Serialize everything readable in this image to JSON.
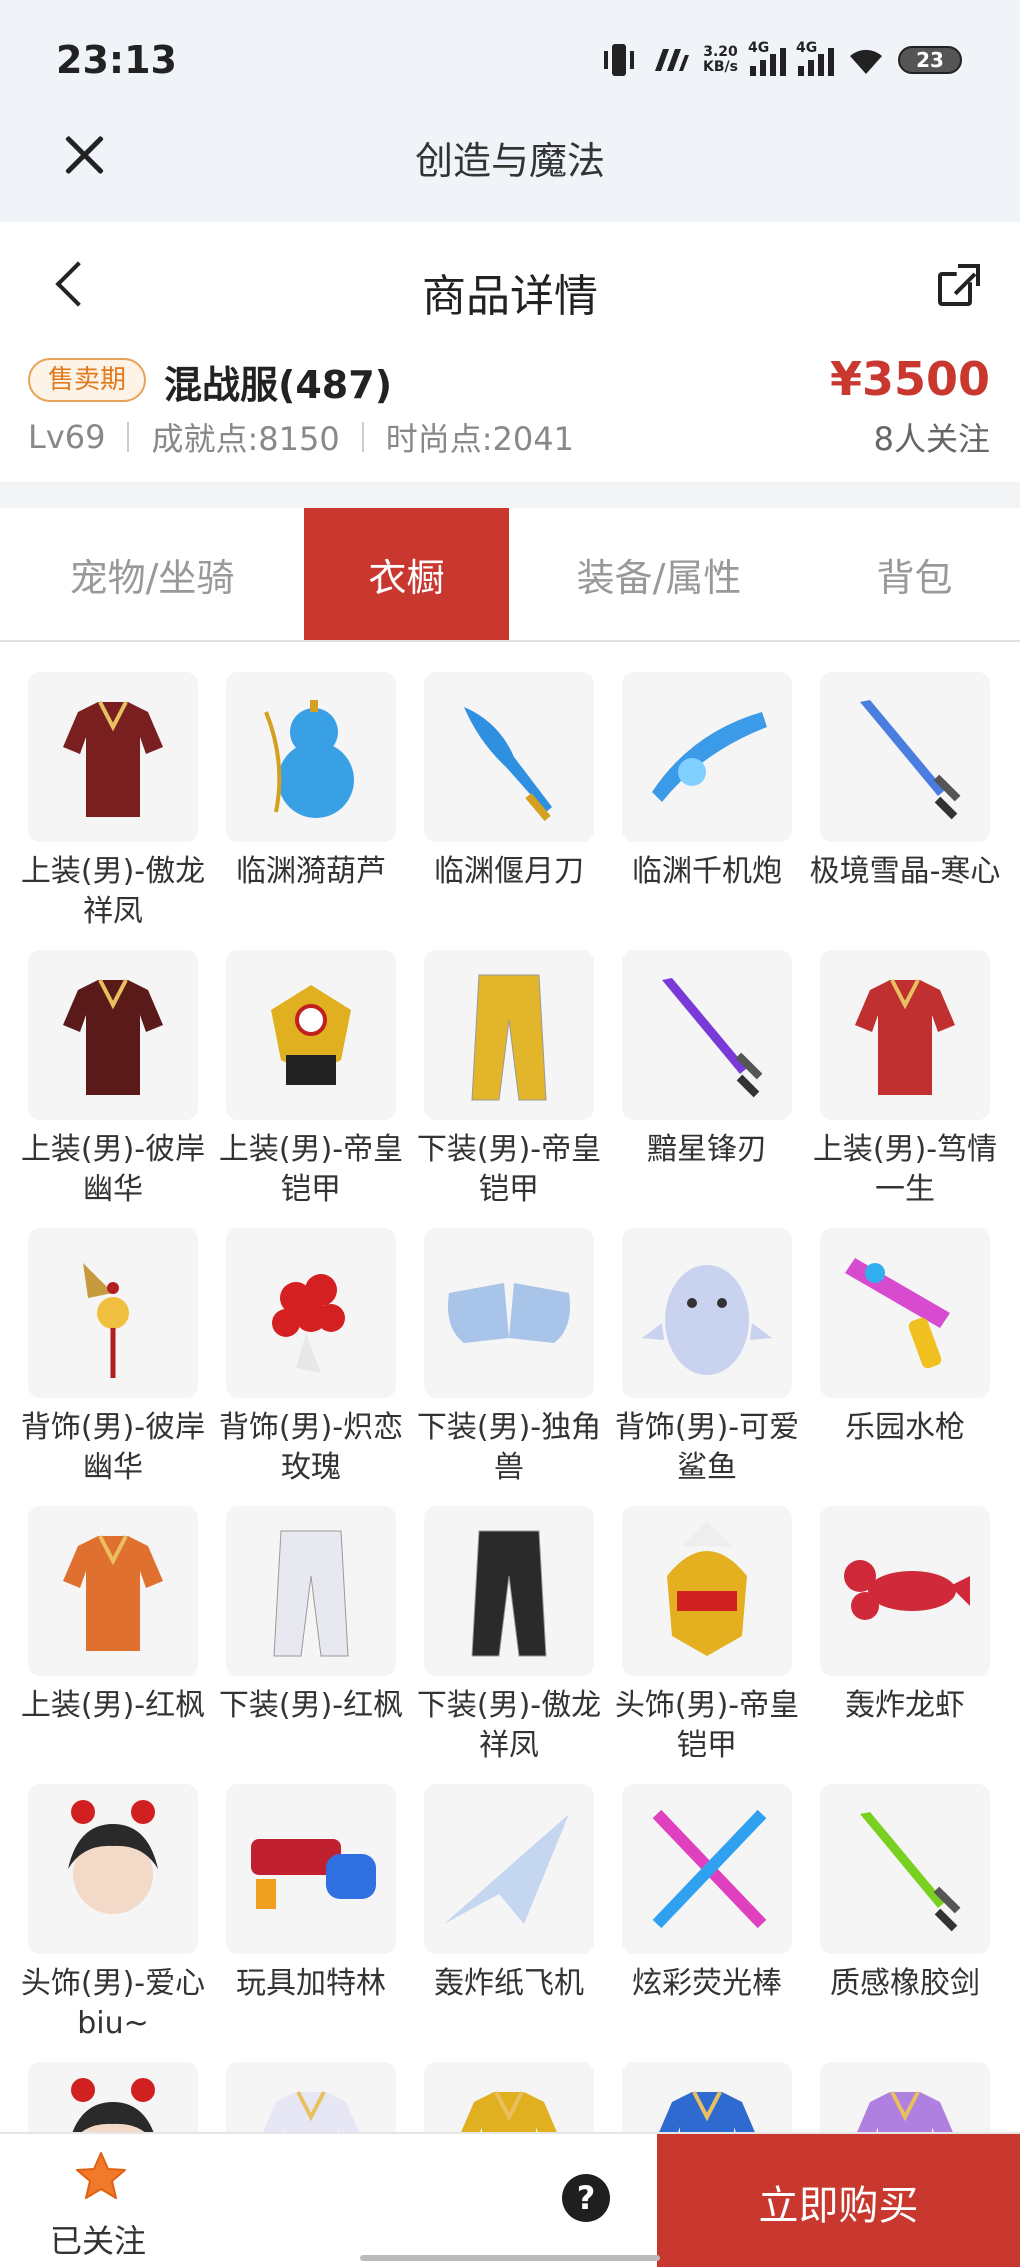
{
  "status_bar": {
    "time": "23:13",
    "net_speed": "3.20",
    "net_unit": "KB/s",
    "signal1": "4G",
    "signal2": "4G",
    "battery": "23"
  },
  "app": {
    "title": "创造与魔法"
  },
  "header": {
    "title": "商品详情"
  },
  "product": {
    "badge": "售卖期",
    "server": "混战服(487)",
    "price": "¥3500",
    "level": "Lv69",
    "achievement": "成就点:8150",
    "fashion": "时尚点:2041",
    "followers": "8人关注"
  },
  "tabs": [
    {
      "label": "宠物/坐骑",
      "active": false
    },
    {
      "label": "衣橱",
      "active": true
    },
    {
      "label": "装备/属性",
      "active": false
    },
    {
      "label": "背包",
      "active": false
    }
  ],
  "items": [
    {
      "name": "上装(男)-傲龙祥凤",
      "icon": "outfit-icon",
      "color": "#7a1f1f"
    },
    {
      "name": "临渊漪葫芦",
      "icon": "gourd-icon",
      "color": "#3aa0e6"
    },
    {
      "name": "临渊偃月刀",
      "icon": "blade-icon",
      "color": "#2f8fe0"
    },
    {
      "name": "临渊千机炮",
      "icon": "cannon-icon",
      "color": "#3c9be8"
    },
    {
      "name": "极境雪晶-寒心",
      "icon": "sword-icon",
      "color": "#4a7de0"
    },
    {
      "name": "上装(男)-彼岸幽华",
      "icon": "outfit-icon",
      "color": "#5a1a1a"
    },
    {
      "name": "上装(男)-帝皇铠甲",
      "icon": "armor-icon",
      "color": "#e0b020"
    },
    {
      "name": "下装(男)-帝皇铠甲",
      "icon": "pants-icon",
      "color": "#e3b52a"
    },
    {
      "name": "黯星锋刃",
      "icon": "sword-icon",
      "color": "#7a3ad8"
    },
    {
      "name": "上装(男)-笃情一生",
      "icon": "outfit-icon",
      "color": "#c03030"
    },
    {
      "name": "背饰(男)-彼岸幽华",
      "icon": "fan-icon",
      "color": "#b02020"
    },
    {
      "name": "背饰(男)-炽恋玫瑰",
      "icon": "rose-icon",
      "color": "#d42020"
    },
    {
      "name": "下装(男)-独角兽",
      "icon": "boots-icon",
      "color": "#a8c4e8"
    },
    {
      "name": "背饰(男)-可爱鲨鱼",
      "icon": "shark-icon",
      "color": "#c9d3f0"
    },
    {
      "name": "乐园水枪",
      "icon": "watergun-icon",
      "color": "#d84ad0"
    },
    {
      "name": "上装(男)-红枫",
      "icon": "outfit-icon",
      "color": "#e07030"
    },
    {
      "name": "下装(男)-红枫",
      "icon": "pants-icon",
      "color": "#e8e8f0"
    },
    {
      "name": "下装(男)-傲龙祥凤",
      "icon": "pants-icon",
      "color": "#2a2a2a"
    },
    {
      "name": "头饰(男)-帝皇铠甲",
      "icon": "helmet-icon",
      "color": "#e4b020"
    },
    {
      "name": "轰炸龙虾",
      "icon": "lobster-icon",
      "color": "#d02a3a"
    },
    {
      "name": "头饰(男)-爱心biu~",
      "icon": "head-icon",
      "color": "#2a2a2a"
    },
    {
      "name": "玩具加特林",
      "icon": "gatling-icon",
      "color": "#c02030"
    },
    {
      "name": "轰炸纸飞机",
      "icon": "plane-icon",
      "color": "#c0d4f0"
    },
    {
      "name": "炫彩荧光棒",
      "icon": "glowstick-icon",
      "color": "#e040c0"
    },
    {
      "name": "质感橡胶剑",
      "icon": "sword-icon",
      "color": "#7ad020"
    },
    {
      "name": "",
      "icon": "head-icon",
      "color": "#2a2a2a"
    },
    {
      "name": "",
      "icon": "outfit-icon",
      "color": "#e6e6f4"
    },
    {
      "name": "",
      "icon": "outfit-icon",
      "color": "#e0b020"
    },
    {
      "name": "",
      "icon": "outfit-icon",
      "color": "#2f6ad0"
    },
    {
      "name": "",
      "icon": "outfit-icon",
      "color": "#b080e0"
    }
  ],
  "bottom": {
    "follow_label": "已关注",
    "help_symbol": "?",
    "buy_label": "立即购买"
  }
}
